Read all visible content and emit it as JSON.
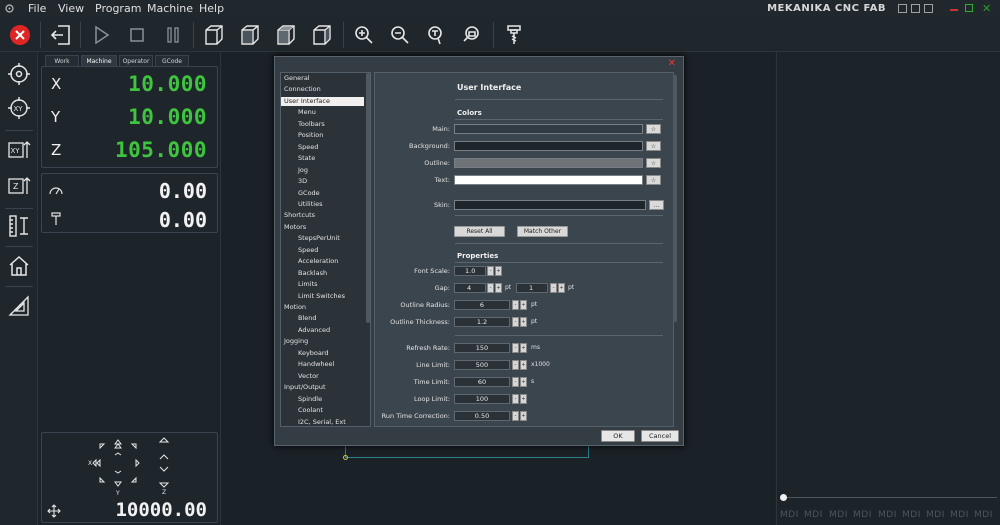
{
  "app": {
    "title": "MEKANIKA CNC FAB",
    "menu": [
      "File",
      "View",
      "Program",
      "Machine",
      "Help"
    ]
  },
  "toolbar": {
    "icons": [
      "estop-icon",
      "exit-icon",
      "play-icon",
      "stop-icon",
      "pause-icon",
      "view-iso-icon",
      "view-front-icon",
      "view-top-icon",
      "view-side-icon",
      "zoom-in-icon",
      "zoom-out-icon",
      "zoom-fit-icon",
      "zoom-selection-icon",
      "tool-icon"
    ]
  },
  "sidebar": {
    "icons": [
      "probe-origin-icon",
      "probe-xy-icon",
      "set-xy-icon",
      "set-z-icon",
      "tool-measure-icon",
      "home-icon",
      "workpiece-icon"
    ]
  },
  "dro": {
    "tabs": [
      "Work",
      "Machine",
      "Operator",
      "GCode"
    ],
    "active_tab": "Machine",
    "axes": [
      {
        "label": "X",
        "value": "10.000"
      },
      {
        "label": "Y",
        "value": "10.000"
      },
      {
        "label": "Z",
        "value": "105.000"
      }
    ],
    "feed": "0.00",
    "spindle": "0.00",
    "jog_labels": {
      "x": "X",
      "y": "Y",
      "z": "Z"
    },
    "jog_speed": "10000.00"
  },
  "dialog": {
    "nav": [
      {
        "label": "General",
        "indent": 0
      },
      {
        "label": "Connection",
        "indent": 0
      },
      {
        "label": "User Interface",
        "indent": 0,
        "selected": true
      },
      {
        "label": "Menu",
        "indent": 1
      },
      {
        "label": "Toolbars",
        "indent": 1
      },
      {
        "label": "Position",
        "indent": 1
      },
      {
        "label": "Speed",
        "indent": 1
      },
      {
        "label": "State",
        "indent": 1
      },
      {
        "label": "Jog",
        "indent": 1
      },
      {
        "label": "3D",
        "indent": 1
      },
      {
        "label": "GCode",
        "indent": 1
      },
      {
        "label": "Utilities",
        "indent": 1
      },
      {
        "label": "Shortcuts",
        "indent": 0
      },
      {
        "label": "Motors",
        "indent": 0
      },
      {
        "label": "StepsPerUnit",
        "indent": 1
      },
      {
        "label": "Speed",
        "indent": 1
      },
      {
        "label": "Acceleration",
        "indent": 1
      },
      {
        "label": "Backlash",
        "indent": 1
      },
      {
        "label": "Limits",
        "indent": 1
      },
      {
        "label": "Limit Switches",
        "indent": 1
      },
      {
        "label": "Motion",
        "indent": 0
      },
      {
        "label": "Blend",
        "indent": 1
      },
      {
        "label": "Advanced",
        "indent": 1
      },
      {
        "label": "Jogging",
        "indent": 0
      },
      {
        "label": "Keyboard",
        "indent": 1
      },
      {
        "label": "Handwheel",
        "indent": 1
      },
      {
        "label": "Vector",
        "indent": 1
      },
      {
        "label": "Input/Output",
        "indent": 0
      },
      {
        "label": "Spindle",
        "indent": 1
      },
      {
        "label": "Coolant",
        "indent": 1
      },
      {
        "label": "I2C, Serial, Ext",
        "indent": 1
      }
    ],
    "title": "User Interface",
    "colors_heading": "Colors",
    "colors": [
      {
        "label": "Main:",
        "color": "#333b42"
      },
      {
        "label": "Background:",
        "color": "#1e252b"
      },
      {
        "label": "Outline:",
        "color": "#6f7276"
      },
      {
        "label": "Text:",
        "color": "#ffffff"
      }
    ],
    "skin_label": "Skin:",
    "skin_value": "",
    "skin_browse": "...",
    "reset_all": "Reset All",
    "match_other": "Match Other",
    "properties_heading": "Properties",
    "font_scale": {
      "label": "Font Scale:",
      "value": "1.0"
    },
    "gap": {
      "label": "Gap:",
      "value1": "4",
      "unit1": "pt",
      "value2": "1",
      "unit2": "pt"
    },
    "outline_radius": {
      "label": "Outline Radius:",
      "value": "6",
      "unit": "pt"
    },
    "outline_thickness": {
      "label": "Outline Thickness:",
      "value": "1.2",
      "unit": "pt"
    },
    "refresh_rate": {
      "label": "Refresh Rate:",
      "value": "150",
      "unit": "ms"
    },
    "line_limit": {
      "label": "Line Limit:",
      "value": "500",
      "unit": "x1000"
    },
    "time_limit": {
      "label": "Time Limit:",
      "value": "60",
      "unit": "s"
    },
    "loop_limit": {
      "label": "Loop Limit:",
      "value": "100",
      "unit": ""
    },
    "run_time_correction": {
      "label": "Run Time Correction:",
      "value": "0.50",
      "unit": ""
    },
    "ok": "OK",
    "cancel": "Cancel",
    "spin_minus": "-",
    "spin_plus": "+",
    "color_pick": "☆"
  },
  "mdi": {
    "labels": [
      "MDI",
      "MDI",
      "MDI",
      "MDI",
      "MDI",
      "MDI",
      "MDI",
      "MDI",
      "MDI"
    ]
  }
}
